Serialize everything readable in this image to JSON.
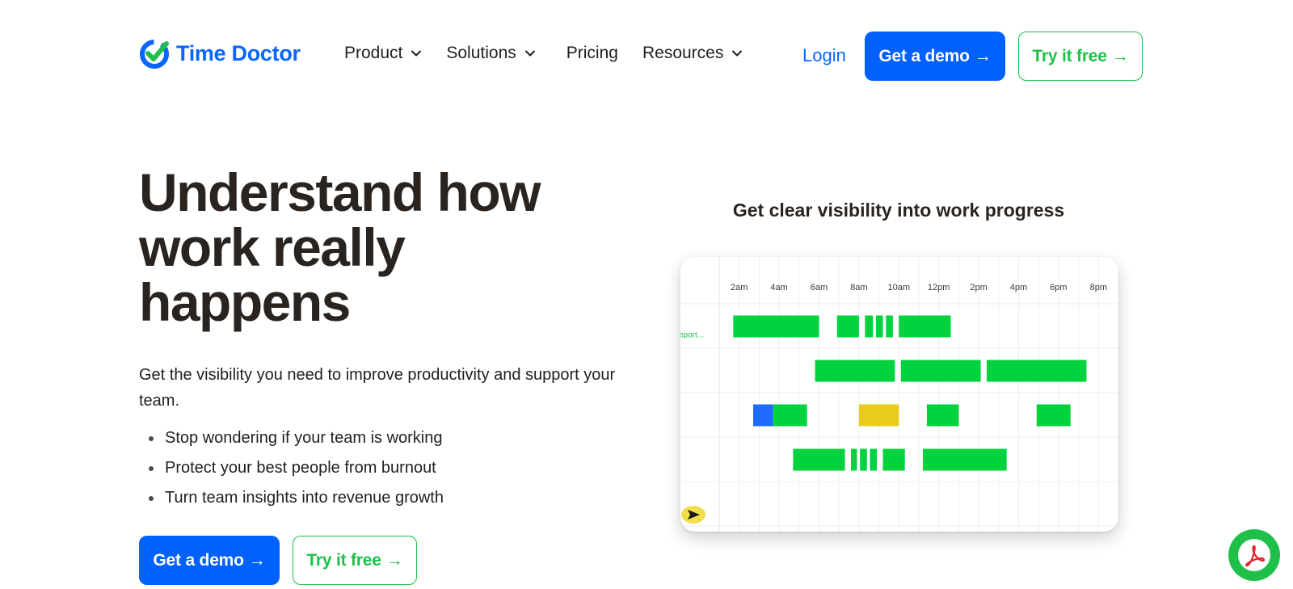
{
  "brand": {
    "name": "Time Doctor",
    "color": "#0a66ff",
    "check_color": "#1fc04a"
  },
  "nav": {
    "items": [
      {
        "label": "Product",
        "has_dropdown": true
      },
      {
        "label": "Solutions",
        "has_dropdown": true
      },
      {
        "label": "Pricing",
        "has_dropdown": false
      },
      {
        "label": "Resources",
        "has_dropdown": true
      }
    ],
    "login": "Login",
    "demo_label": "Get a demo",
    "try_label": "Try it free",
    "arrow": "→"
  },
  "hero": {
    "title_lines": [
      "Understand how",
      "work really",
      "happens"
    ],
    "subtitle": "Get the visibility you need to improve productivity and support your team.",
    "bullets": [
      "Stop wondering if your team is working",
      "Protect your best people from burnout",
      "Turn team insights into revenue growth"
    ],
    "demo_label": "Get a demo",
    "try_label": "Try it free",
    "arrow": "→"
  },
  "panel": {
    "heading": "Get clear visibility into work progress",
    "row_label": "eport...",
    "chart_data": {
      "type": "timeline",
      "time_labels": [
        "2am",
        "4am",
        "6am",
        "8am",
        "10am",
        "12pm",
        "2pm",
        "4pm",
        "6pm",
        "8pm"
      ],
      "hour_range": [
        1,
        21
      ],
      "rows": [
        {
          "segments": [
            {
              "start": 1.7,
              "end": 6.0,
              "status": "productive"
            },
            {
              "start": 6.9,
              "end": 8.0,
              "status": "productive"
            },
            {
              "start": 8.3,
              "end": 8.7,
              "status": "productive"
            },
            {
              "start": 8.85,
              "end": 9.2,
              "status": "productive"
            },
            {
              "start": 9.35,
              "end": 9.7,
              "status": "productive"
            },
            {
              "start": 10.0,
              "end": 12.6,
              "status": "productive"
            }
          ]
        },
        {
          "segments": [
            {
              "start": 5.8,
              "end": 9.8,
              "status": "productive"
            },
            {
              "start": 10.1,
              "end": 14.1,
              "status": "productive"
            },
            {
              "start": 14.4,
              "end": 19.4,
              "status": "productive"
            }
          ]
        },
        {
          "segments": [
            {
              "start": 2.7,
              "end": 3.7,
              "status": "other"
            },
            {
              "start": 3.7,
              "end": 5.4,
              "status": "productive"
            },
            {
              "start": 8.0,
              "end": 10.0,
              "status": "idle"
            },
            {
              "start": 11.4,
              "end": 13.0,
              "status": "productive"
            },
            {
              "start": 16.9,
              "end": 18.6,
              "status": "productive"
            }
          ]
        },
        {
          "segments": [
            {
              "start": 4.7,
              "end": 7.3,
              "status": "productive"
            },
            {
              "start": 7.6,
              "end": 7.9,
              "status": "productive"
            },
            {
              "start": 8.05,
              "end": 8.4,
              "status": "productive"
            },
            {
              "start": 8.55,
              "end": 8.9,
              "status": "productive"
            },
            {
              "start": 9.2,
              "end": 10.3,
              "status": "productive"
            },
            {
              "start": 11.2,
              "end": 15.4,
              "status": "productive"
            }
          ]
        }
      ],
      "status_colors": {
        "productive": "#00d33d",
        "other": "#1f6bff",
        "idle": "#e9cc1b"
      }
    }
  },
  "colors": {
    "primary": "#0061ff",
    "green": "#1fc04a",
    "text": "#231f1c"
  }
}
